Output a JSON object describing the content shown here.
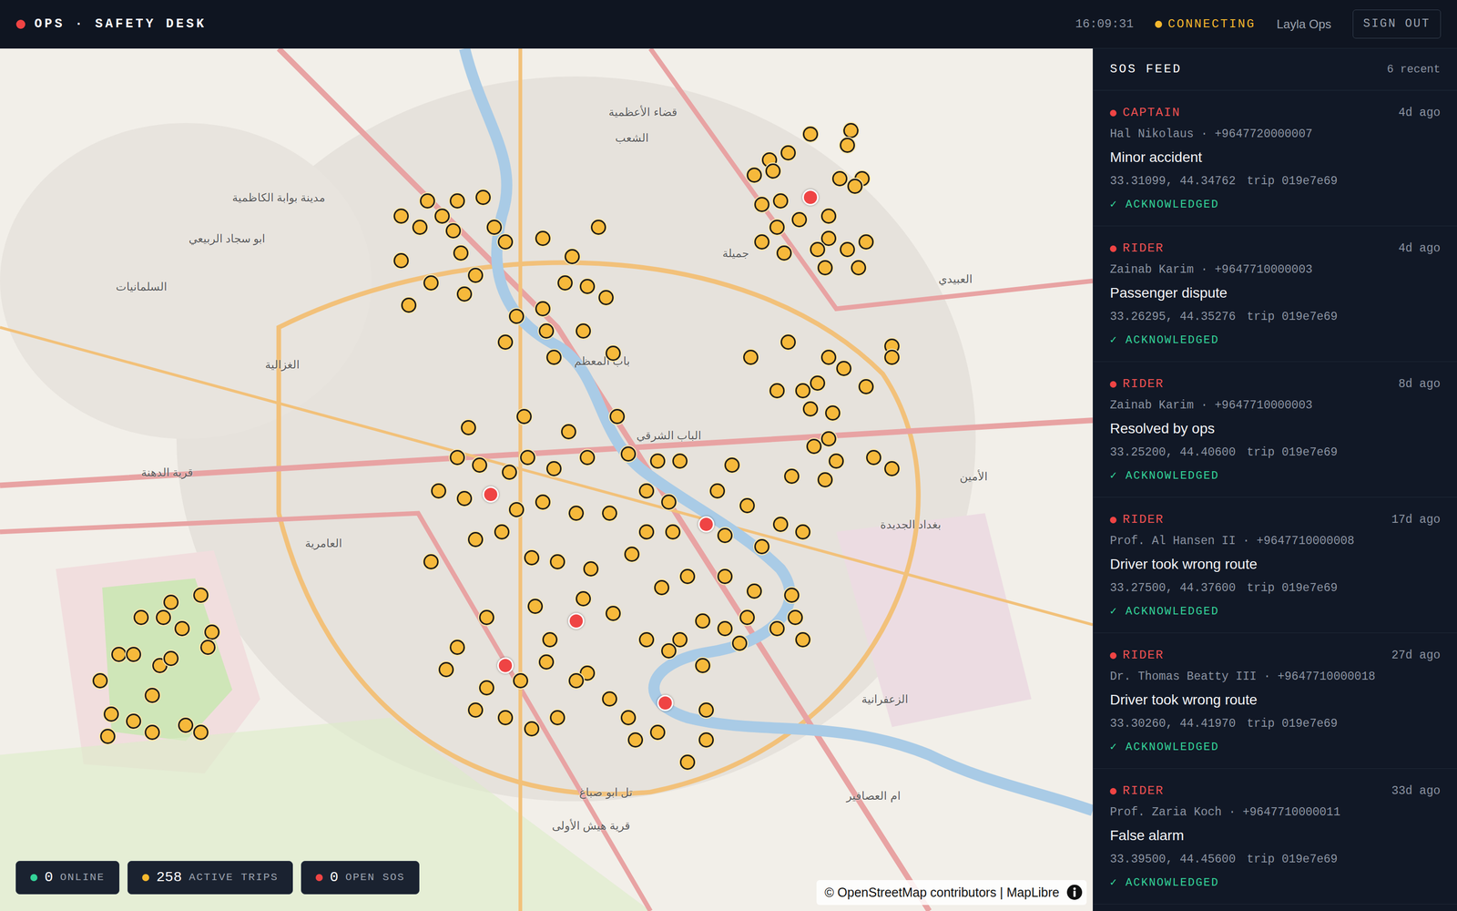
{
  "header": {
    "brand": "OPS · SAFETY DESK",
    "clock": "16:09:31",
    "connection": {
      "label": "CONNECTING",
      "color": "#f5b82e"
    },
    "user": "Layla Ops",
    "sign_out": "SIGN OUT"
  },
  "map": {
    "labels": [
      {
        "text": "قضاء الأعظمية",
        "lat": 33.42,
        "lng": 44.373
      },
      {
        "text": "الشعب",
        "lat": 33.413,
        "lng": 44.37
      },
      {
        "text": "مدينة بوابة الكاظمية",
        "lat": 33.397,
        "lng": 44.275
      },
      {
        "text": "ابو سجاد الربيعي",
        "lat": 33.386,
        "lng": 44.261
      },
      {
        "text": "جميلة",
        "lat": 33.382,
        "lng": 44.398
      },
      {
        "text": "السلمانيات",
        "lat": 33.373,
        "lng": 44.238
      },
      {
        "text": "العبيدي",
        "lat": 33.375,
        "lng": 44.457
      },
      {
        "text": "باب المعظم",
        "lat": 33.353,
        "lng": 44.362
      },
      {
        "text": "الغزالية",
        "lat": 33.352,
        "lng": 44.276
      },
      {
        "text": "الباب الشرقي",
        "lat": 33.333,
        "lng": 44.38
      },
      {
        "text": "قرية الدهنة",
        "lat": 33.323,
        "lng": 44.245
      },
      {
        "text": "الأمين",
        "lat": 33.322,
        "lng": 44.462
      },
      {
        "text": "بغداد الجديدة",
        "lat": 33.309,
        "lng": 44.445
      },
      {
        "text": "العامرية",
        "lat": 33.304,
        "lng": 44.287
      },
      {
        "text": "الزعفرانية",
        "lat": 33.262,
        "lng": 44.438
      },
      {
        "text": "ام العصافير",
        "lat": 33.236,
        "lng": 44.435
      },
      {
        "text": "تل ابو صباغ",
        "lat": 33.237,
        "lng": 44.363
      },
      {
        "text": "قرية هيش الأولى",
        "lat": 33.228,
        "lng": 44.359
      }
    ],
    "trip_pins": [
      [
        33.414,
        44.418
      ],
      [
        33.415,
        44.429
      ],
      [
        33.411,
        44.428
      ],
      [
        33.409,
        44.412
      ],
      [
        33.407,
        44.407
      ],
      [
        33.403,
        44.403
      ],
      [
        33.404,
        44.408
      ],
      [
        33.402,
        44.426
      ],
      [
        33.402,
        44.432
      ],
      [
        33.395,
        44.405
      ],
      [
        33.396,
        44.41
      ],
      [
        33.391,
        44.415
      ],
      [
        33.389,
        44.409
      ],
      [
        33.385,
        44.405
      ],
      [
        33.382,
        44.411
      ],
      [
        33.378,
        44.422
      ],
      [
        33.378,
        44.431
      ],
      [
        33.385,
        44.433
      ],
      [
        33.383,
        44.428
      ],
      [
        33.386,
        44.423
      ],
      [
        33.383,
        44.42
      ],
      [
        33.392,
        44.423
      ],
      [
        33.4,
        44.43
      ],
      [
        33.396,
        44.315
      ],
      [
        33.396,
        44.323
      ],
      [
        33.397,
        44.33
      ],
      [
        33.392,
        44.308
      ],
      [
        33.389,
        44.313
      ],
      [
        33.392,
        44.319
      ],
      [
        33.388,
        44.322
      ],
      [
        33.38,
        44.308
      ],
      [
        33.374,
        44.316
      ],
      [
        33.368,
        44.31
      ],
      [
        33.371,
        44.325
      ],
      [
        33.385,
        44.336
      ],
      [
        33.386,
        44.346
      ],
      [
        33.389,
        44.361
      ],
      [
        33.381,
        44.354
      ],
      [
        33.374,
        44.352
      ],
      [
        33.373,
        44.358
      ],
      [
        33.37,
        44.363
      ],
      [
        33.367,
        44.346
      ],
      [
        33.365,
        44.339
      ],
      [
        33.361,
        44.347
      ],
      [
        33.361,
        44.357
      ],
      [
        33.355,
        44.365
      ],
      [
        33.354,
        44.349
      ],
      [
        33.358,
        44.336
      ],
      [
        33.376,
        44.328
      ],
      [
        33.382,
        44.324
      ],
      [
        33.389,
        44.333
      ],
      [
        33.354,
        44.402
      ],
      [
        33.358,
        44.412
      ],
      [
        33.354,
        44.423
      ],
      [
        33.357,
        44.44
      ],
      [
        33.354,
        44.44
      ],
      [
        33.351,
        44.427
      ],
      [
        33.347,
        44.42
      ],
      [
        33.346,
        44.433
      ],
      [
        33.345,
        44.409
      ],
      [
        33.345,
        44.416
      ],
      [
        33.34,
        44.418
      ],
      [
        33.339,
        44.424
      ],
      [
        33.327,
        44.435
      ],
      [
        33.324,
        44.44
      ],
      [
        33.33,
        44.419
      ],
      [
        33.326,
        44.425
      ],
      [
        33.322,
        44.413
      ],
      [
        33.321,
        44.422
      ],
      [
        33.332,
        44.423
      ],
      [
        33.335,
        44.326
      ],
      [
        33.338,
        44.341
      ],
      [
        33.334,
        44.353
      ],
      [
        33.338,
        44.366
      ],
      [
        33.327,
        44.323
      ],
      [
        33.325,
        44.329
      ],
      [
        33.323,
        44.337
      ],
      [
        33.327,
        44.342
      ],
      [
        33.324,
        44.349
      ],
      [
        33.327,
        44.358
      ],
      [
        33.328,
        44.369
      ],
      [
        33.326,
        44.377
      ],
      [
        33.326,
        44.383
      ],
      [
        33.315,
        44.38
      ],
      [
        33.318,
        44.374
      ],
      [
        33.318,
        44.393
      ],
      [
        33.325,
        44.397
      ],
      [
        33.314,
        44.401
      ],
      [
        33.309,
        44.41
      ],
      [
        33.307,
        44.416
      ],
      [
        33.318,
        44.318
      ],
      [
        33.316,
        44.325
      ],
      [
        33.313,
        44.339
      ],
      [
        33.315,
        44.346
      ],
      [
        33.312,
        44.355
      ],
      [
        33.312,
        44.364
      ],
      [
        33.307,
        44.374
      ],
      [
        33.307,
        44.381
      ],
      [
        33.306,
        44.395
      ],
      [
        33.303,
        44.405
      ],
      [
        33.299,
        44.316
      ],
      [
        33.305,
        44.328
      ],
      [
        33.307,
        44.335
      ],
      [
        33.3,
        44.343
      ],
      [
        33.299,
        44.35
      ],
      [
        33.297,
        44.359
      ],
      [
        33.301,
        44.37
      ],
      [
        33.292,
        44.378
      ],
      [
        33.295,
        44.385
      ],
      [
        33.295,
        44.395
      ],
      [
        33.291,
        44.403
      ],
      [
        33.29,
        44.413
      ],
      [
        33.284,
        44.414
      ],
      [
        33.284,
        44.401
      ],
      [
        33.283,
        44.389
      ],
      [
        33.278,
        44.383
      ],
      [
        33.278,
        44.374
      ],
      [
        33.285,
        44.365
      ],
      [
        33.289,
        44.357
      ],
      [
        33.287,
        44.344
      ],
      [
        33.284,
        44.331
      ],
      [
        33.276,
        44.323
      ],
      [
        33.27,
        44.32
      ],
      [
        33.265,
        44.331
      ],
      [
        33.267,
        44.34
      ],
      [
        33.272,
        44.347
      ],
      [
        33.269,
        44.358
      ],
      [
        33.262,
        44.364
      ],
      [
        33.251,
        44.371
      ],
      [
        33.253,
        44.377
      ],
      [
        33.271,
        44.389
      ],
      [
        33.259,
        44.39
      ],
      [
        33.281,
        44.395
      ],
      [
        33.277,
        44.399
      ],
      [
        33.281,
        44.409
      ],
      [
        33.278,
        44.416
      ],
      [
        33.245,
        44.385
      ],
      [
        33.257,
        44.35
      ],
      [
        33.257,
        44.336
      ],
      [
        33.259,
        44.328
      ],
      [
        33.254,
        44.343
      ],
      [
        33.257,
        44.369
      ],
      [
        33.267,
        44.355
      ],
      [
        33.278,
        44.348
      ],
      [
        33.275,
        44.38
      ],
      [
        33.251,
        44.39
      ],
      [
        33.267,
        44.227
      ],
      [
        33.274,
        44.232
      ],
      [
        33.284,
        44.238
      ],
      [
        33.288,
        44.246
      ],
      [
        33.29,
        44.254
      ],
      [
        33.28,
        44.257
      ],
      [
        33.281,
        44.249
      ],
      [
        33.271,
        44.243
      ],
      [
        33.274,
        44.236
      ],
      [
        33.273,
        44.246
      ],
      [
        33.263,
        44.241
      ],
      [
        33.256,
        44.236
      ],
      [
        33.258,
        44.23
      ],
      [
        33.252,
        44.229
      ],
      [
        33.253,
        44.241
      ],
      [
        33.255,
        44.25
      ],
      [
        33.253,
        44.254
      ],
      [
        33.276,
        44.256
      ],
      [
        33.284,
        44.244
      ]
    ],
    "sos_pins": [
      [
        33.397,
        44.418
      ],
      [
        33.317,
        44.332
      ],
      [
        33.309,
        44.39
      ],
      [
        33.283,
        44.355
      ],
      [
        33.271,
        44.336
      ],
      [
        33.261,
        44.379
      ]
    ],
    "attribution": "© OpenStreetMap contributors | MapLibre"
  },
  "stats": [
    {
      "value": "0",
      "label": "ONLINE",
      "color": "#34d399"
    },
    {
      "value": "258",
      "label": "ACTIVE TRIPS",
      "color": "#f5b82e"
    },
    {
      "value": "0",
      "label": "OPEN SOS",
      "color": "#ef4444"
    }
  ],
  "sos_feed": {
    "title": "SOS FEED",
    "count": "6 recent",
    "items": [
      {
        "role": "CAPTAIN",
        "time": "4d ago",
        "contact": "Hal Nikolaus · +9647720000007",
        "title": "Minor accident",
        "coords": "33.31099, 44.34762",
        "trip": "trip 019e7e69",
        "status": "✓ ACKNOWLEDGED",
        "acknowledged": true
      },
      {
        "role": "RIDER",
        "time": "4d ago",
        "contact": "Zainab Karim · +9647710000003",
        "title": "Passenger dispute",
        "coords": "33.26295, 44.35276",
        "trip": "trip 019e7e69",
        "status": "✓ ACKNOWLEDGED",
        "acknowledged": true
      },
      {
        "role": "RIDER",
        "time": "8d ago",
        "contact": "Zainab Karim · +9647710000003",
        "title": "Resolved by ops",
        "coords": "33.25200, 44.40600",
        "trip": "trip 019e7e69",
        "status": "✓ ACKNOWLEDGED",
        "acknowledged": true
      },
      {
        "role": "RIDER",
        "time": "17d ago",
        "contact": "Prof. Al Hansen II · +9647710000008",
        "title": "Driver took wrong route",
        "coords": "33.27500, 44.37600",
        "trip": "trip 019e7e69",
        "status": "✓ ACKNOWLEDGED",
        "acknowledged": true
      },
      {
        "role": "RIDER",
        "time": "27d ago",
        "contact": "Dr. Thomas Beatty III · +9647710000018",
        "title": "Driver took wrong route",
        "coords": "33.30260, 44.41970",
        "trip": "trip 019e7e69",
        "status": "✓ ACKNOWLEDGED",
        "acknowledged": true
      },
      {
        "role": "RIDER",
        "time": "33d ago",
        "contact": "Prof. Zaria Koch · +9647710000011",
        "title": "False alarm",
        "coords": "33.39500, 44.45600",
        "trip": "trip 019e7e69",
        "status": "✓ ACKNOWLEDGED",
        "acknowledged": true
      }
    ]
  }
}
